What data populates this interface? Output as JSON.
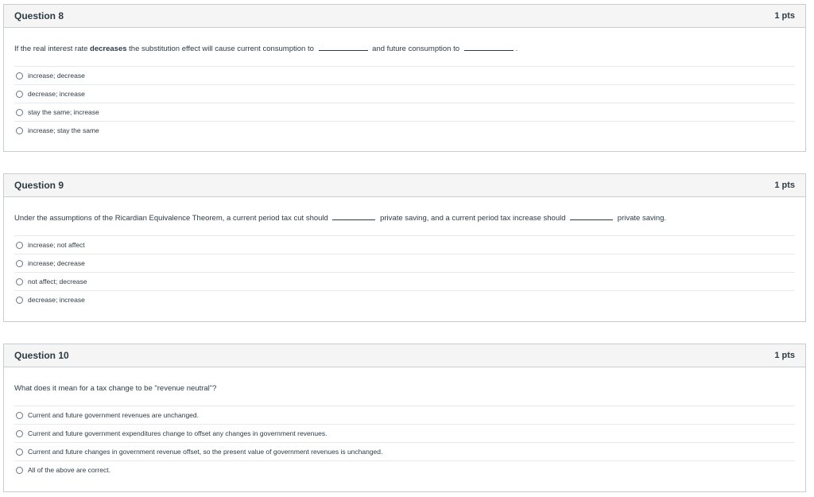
{
  "questions": [
    {
      "title": "Question 8",
      "points": "1 pts",
      "text_parts": [
        "If the real interest rate ",
        "decreases",
        " the substitution effect will cause current consumption to ",
        " and future consumption to ",
        "."
      ],
      "answers": [
        "increase; decrease",
        "decrease; increase",
        "stay the same; increase",
        "increase; stay the same"
      ]
    },
    {
      "title": "Question 9",
      "points": "1 pts",
      "text_parts": [
        "Under the assumptions of the Ricardian Equivalence Theorem, a current period tax cut should ",
        " private saving, and a current period tax increase should ",
        " private saving."
      ],
      "answers": [
        "increase; not affect",
        "increase; decrease",
        "not affect; decrease",
        "decrease; increase"
      ]
    },
    {
      "title": "Question 10",
      "points": "1 pts",
      "text": "What does it mean for a tax change to be \"revenue neutral\"?",
      "answers": [
        "Current and future government revenues are unchanged.",
        "Current and future government expenditures change to offset any changes in government revenues.",
        "Current and future changes in government revenue offset, so the present value of government revenues is unchanged.",
        "All of the above are correct."
      ]
    }
  ]
}
